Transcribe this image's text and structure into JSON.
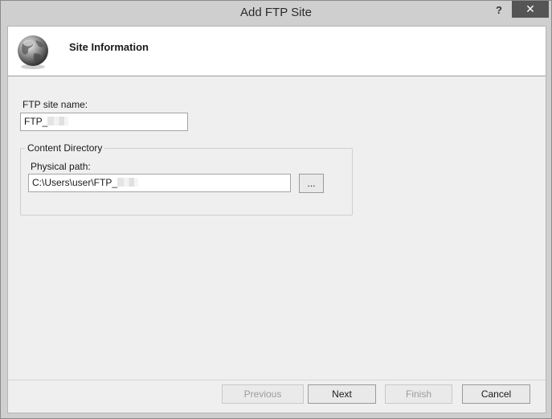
{
  "window": {
    "title": "Add FTP Site",
    "help_label": "?",
    "close_label": "✕"
  },
  "header": {
    "title": "Site Information",
    "icon": "globe-icon"
  },
  "form": {
    "site_name_label": "FTP site name:",
    "site_name_value": "FTP_",
    "content_directory_label": "Content Directory",
    "physical_path_label": "Physical path:",
    "physical_path_value": "C:\\Users\\user\\FTP_",
    "browse_label": "..."
  },
  "footer": {
    "previous_label": "Previous",
    "next_label": "Next",
    "finish_label": "Finish",
    "cancel_label": "Cancel"
  }
}
